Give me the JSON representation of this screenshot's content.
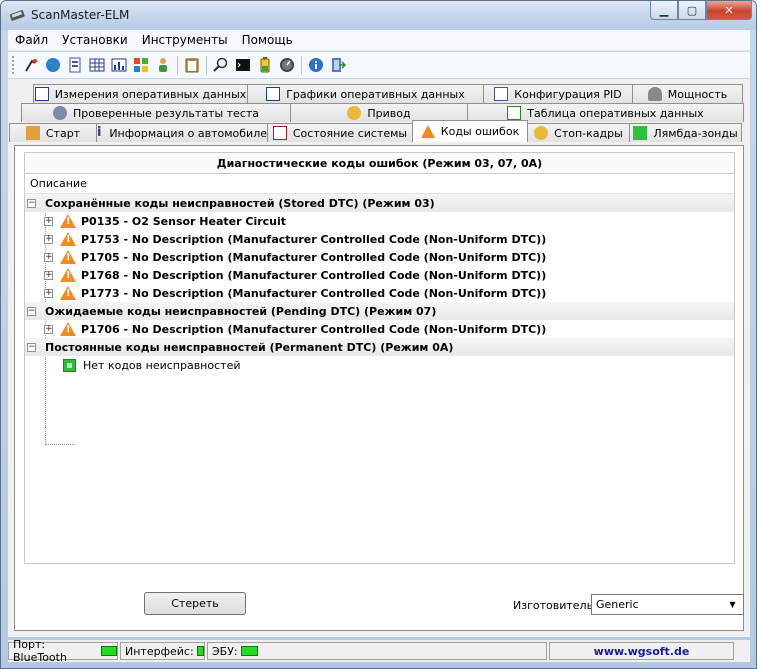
{
  "window": {
    "title": "ScanMaster-ELM"
  },
  "menu": [
    "Файл",
    "Установки",
    "Инструменты",
    "Помощь"
  ],
  "toolbar_icons": [
    "connect-icon",
    "globe-icon",
    "document-icon",
    "grid-icon",
    "chart-icon",
    "windows-icon",
    "person-icon",
    "clipboard-icon",
    "search-icon",
    "terminal-icon",
    "battery-icon",
    "gauge-icon",
    "info-icon",
    "exit-icon"
  ],
  "tabs": {
    "row1": [
      "Измерения оперативных данных",
      "Графики оперативных данных",
      "Конфигурация PID",
      "Мощность"
    ],
    "row2": [
      "Проверенные результаты теста",
      "Привод",
      "Таблица оперативных данных"
    ],
    "row3": [
      "Старт",
      "Информация о автомобиле",
      "Состояние системы",
      "Коды ошибок",
      "Стоп-кадры",
      "Лямбда-зонды"
    ]
  },
  "panel": {
    "header": "Диагностические коды ошибок (Режим 03, 07, 0A)",
    "column": "Описание",
    "groups": [
      {
        "label": "Сохранённые коды неисправностей (Stored DTC) (Режим 03)",
        "items": [
          "P0135 - O2 Sensor Heater Circuit",
          "P1753 - No Description (Manufacturer Controlled Code (Non-Uniform DTC))",
          "P1705 - No Description (Manufacturer Controlled Code (Non-Uniform DTC))",
          "P1768 - No Description (Manufacturer Controlled Code (Non-Uniform DTC))",
          "P1773 - No Description (Manufacturer Controlled Code (Non-Uniform DTC))"
        ]
      },
      {
        "label": "Ожидаемые коды неисправностей (Pending DTC) (Режим 07)",
        "items": [
          "P1706 - No Description (Manufacturer Controlled Code (Non-Uniform DTC))"
        ]
      },
      {
        "label": "Постоянные коды неисправностей (Permanent DTC) (Режим 0A)",
        "note": "Нет кодов неисправностей"
      }
    ],
    "clear_button": "Стереть",
    "manufacturer_label": "Изготовитель",
    "manufacturer_value": "Generic"
  },
  "status": {
    "port": "Порт: BlueTooth",
    "interface": "Интерфейс:",
    "ecu": "ЭБУ:",
    "link": "www.wgsoft.de"
  }
}
